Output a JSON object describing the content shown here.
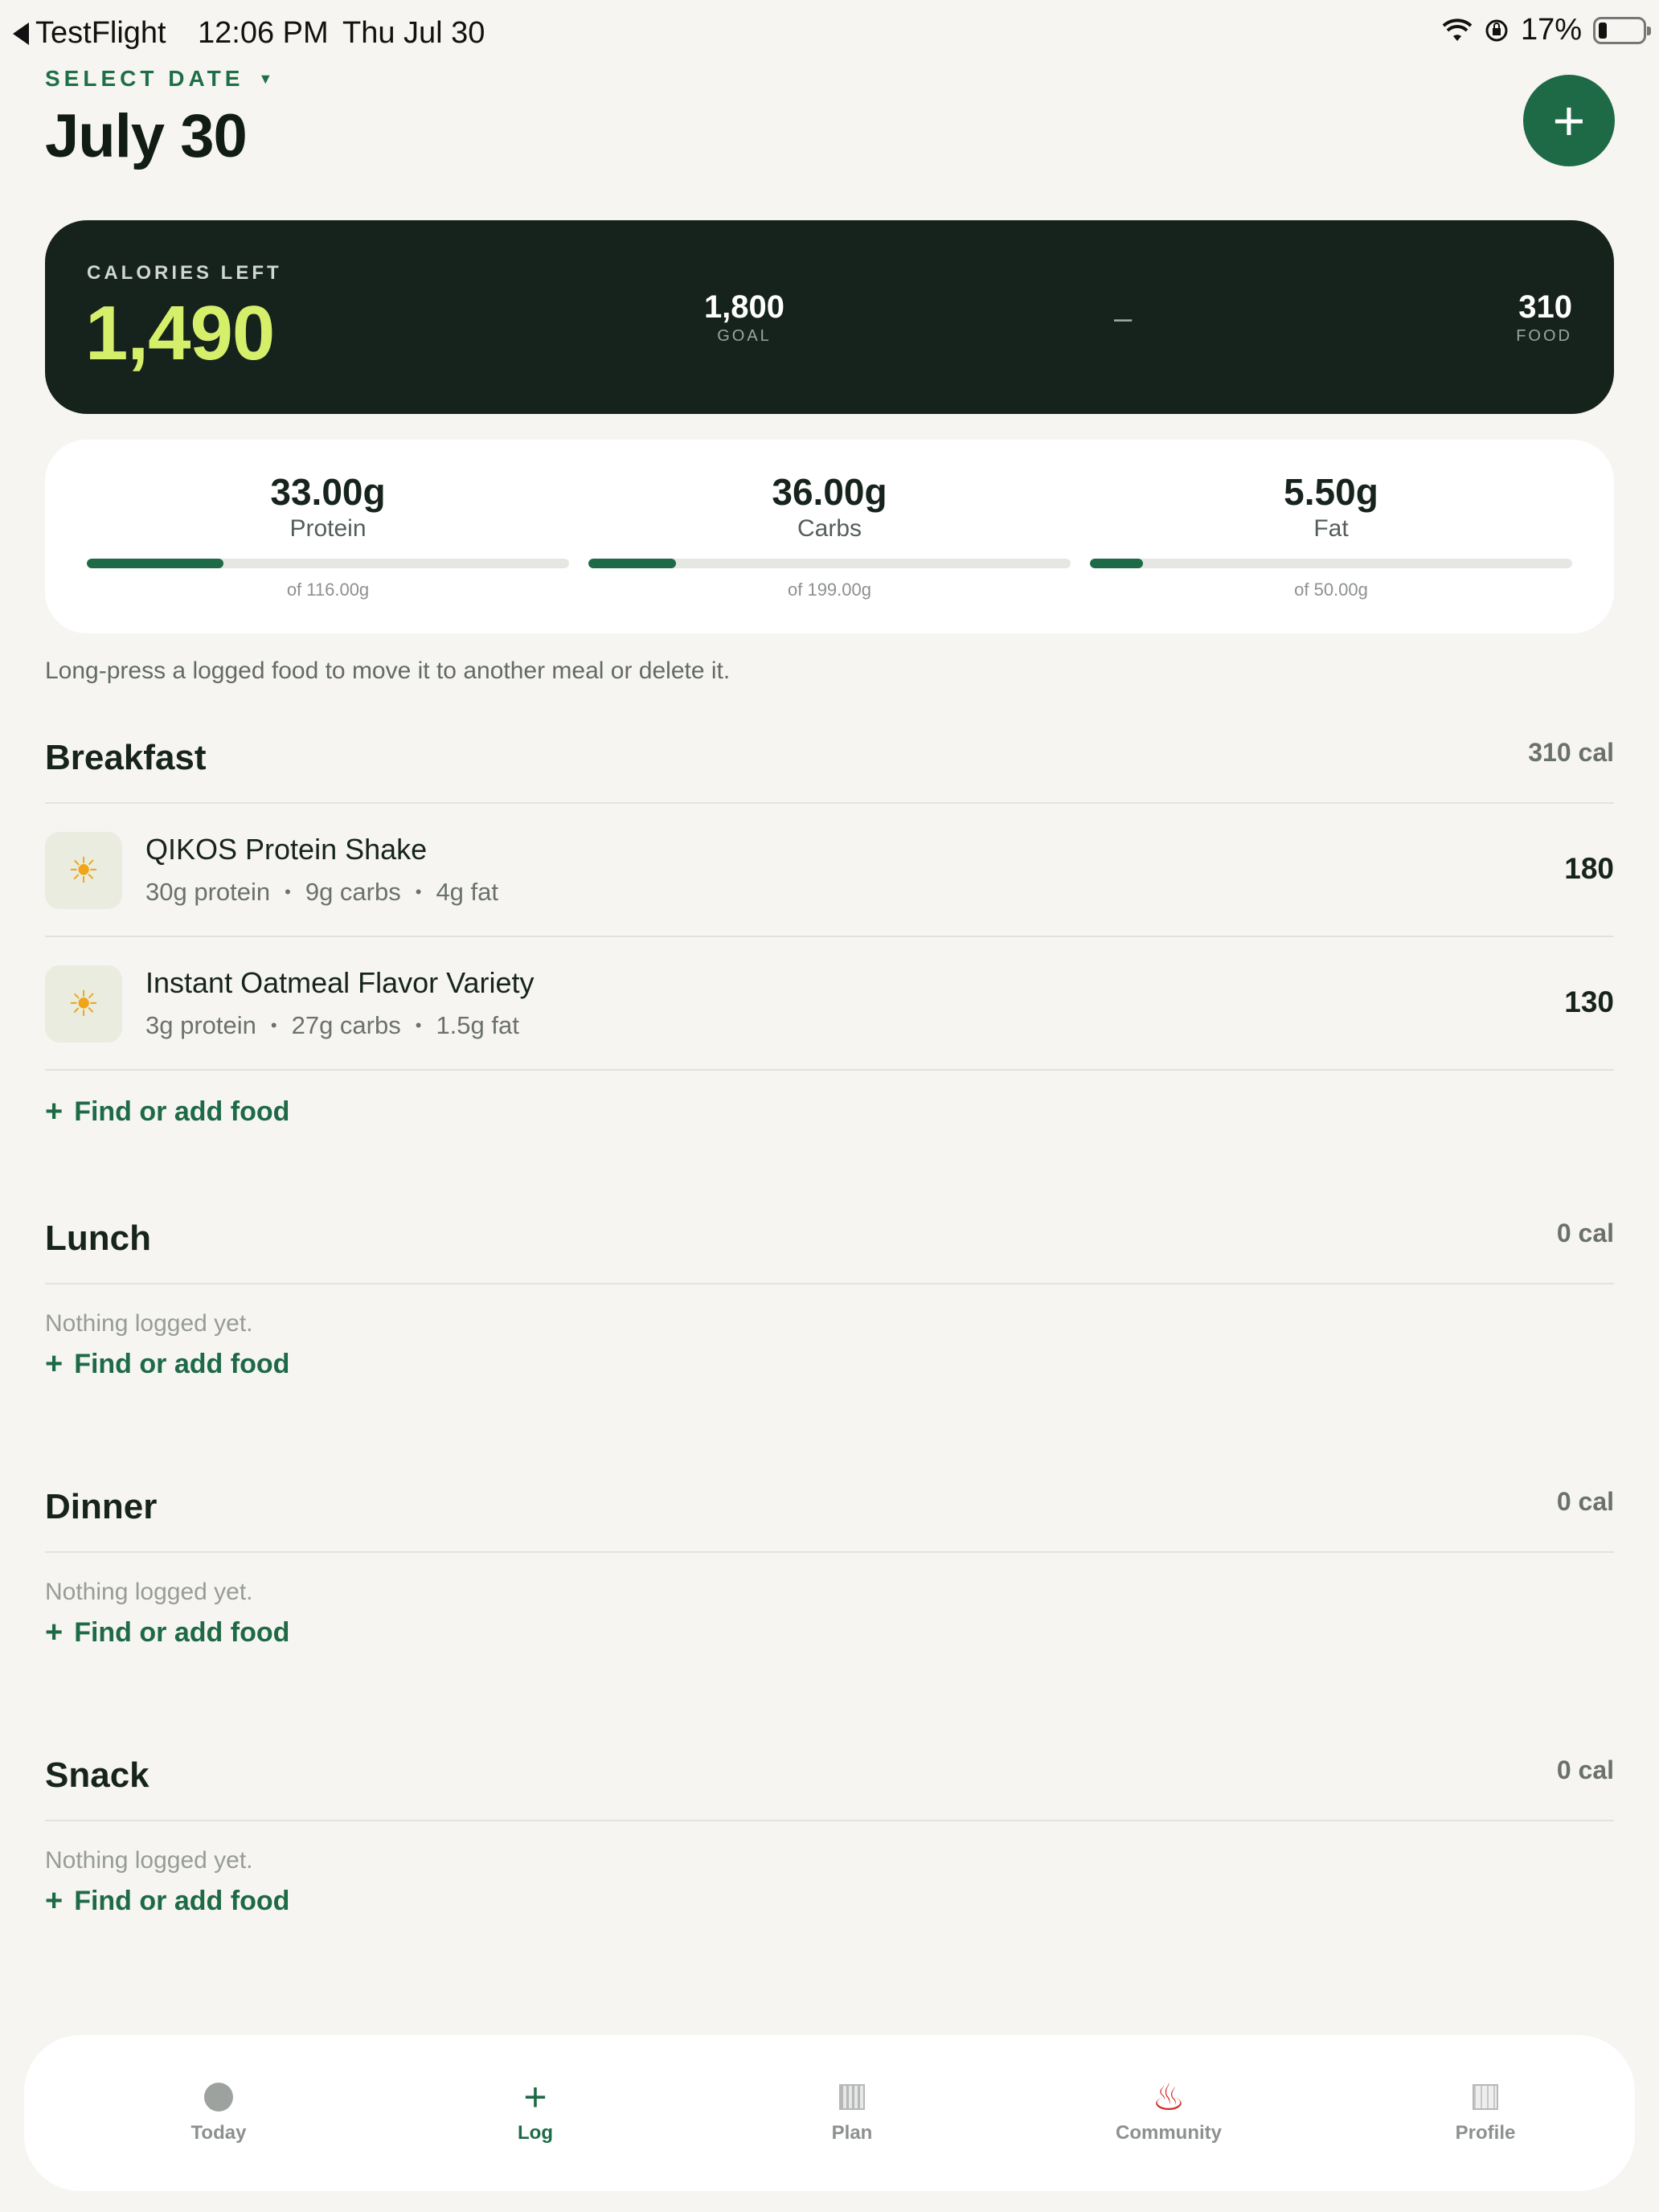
{
  "status_bar": {
    "back_app": "TestFlight",
    "time": "12:06 PM",
    "date": "Thu Jul 30",
    "battery": "17%"
  },
  "header": {
    "select_date_label": "SELECT DATE",
    "title": "July 30",
    "add_button_glyph": "+"
  },
  "calories": {
    "label": "CALORIES LEFT",
    "left": "1,490",
    "goal_value": "1,800",
    "goal_label": "GOAL",
    "separator": "–",
    "food_value": "310",
    "food_label": "FOOD"
  },
  "macros": [
    {
      "amount": "33.00g",
      "name": "Protein",
      "of": "of 116.00g",
      "progress": 0.284
    },
    {
      "amount": "36.00g",
      "name": "Carbs",
      "of": "of 199.00g",
      "progress": 0.181
    },
    {
      "amount": "5.50g",
      "name": "Fat",
      "of": "of 50.00g",
      "progress": 0.11
    }
  ],
  "hint": "Long-press a logged food to move it to another meal or delete it.",
  "meals": {
    "breakfast": {
      "title": "Breakfast",
      "calories": "310 cal",
      "items": [
        {
          "name": "QIKOS Protein Shake",
          "protein": "30g protein",
          "carbs": "9g carbs",
          "fat": "4g fat",
          "calories": "180",
          "icon": "sun-icon"
        },
        {
          "name": "Instant Oatmeal Flavor Variety",
          "protein": "3g protein",
          "carbs": "27g carbs",
          "fat": "1.5g fat",
          "calories": "130",
          "icon": "sun-icon"
        }
      ],
      "add_label": "Find or add food"
    },
    "lunch": {
      "title": "Lunch",
      "calories": "0 cal",
      "empty": "Nothing logged yet.",
      "add_label": "Find or add food"
    },
    "dinner": {
      "title": "Dinner",
      "calories": "0 cal",
      "empty": "Nothing logged yet.",
      "add_label": "Find or add food"
    },
    "snack": {
      "title": "Snack",
      "calories": "0 cal",
      "empty": "Nothing logged yet.",
      "add_label": "Find or add food"
    }
  },
  "tabs": [
    {
      "label": "Today",
      "icon": "circle-icon"
    },
    {
      "label": "Log",
      "icon": "plus-icon",
      "active": true
    },
    {
      "label": "Plan",
      "icon": "grid-icon"
    },
    {
      "label": "Community",
      "icon": "hot-springs-icon"
    },
    {
      "label": "Profile",
      "icon": "book-icon"
    }
  ],
  "colors": {
    "accent": "#1e6a46",
    "dark_card": "#16231c",
    "calories_highlight": "#d6ef6b",
    "background": "#f6f5f1"
  }
}
